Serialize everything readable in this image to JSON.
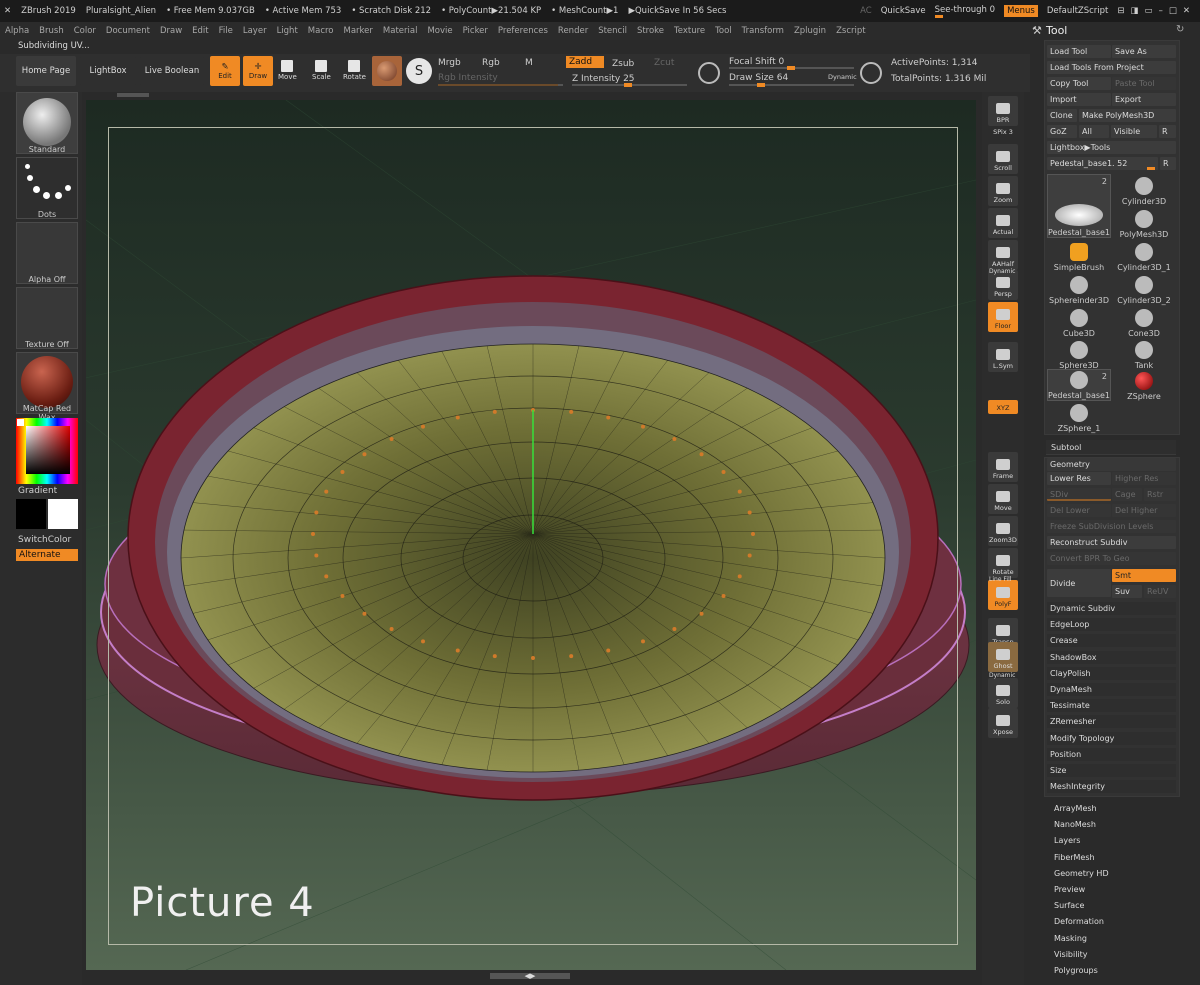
{
  "titlebar": {
    "app": "ZBrush 2019",
    "file": "Pluralsight_Alien",
    "free_mem": "• Free Mem 9.037GB",
    "active_mem": "• Active Mem 753",
    "scratch": "• Scratch Disk 212",
    "polycount": "• PolyCount▶21.504 KP",
    "meshcount": "• MeshCount▶1",
    "quicksave_in": "▶QuickSave In 56 Secs",
    "ac": "AC",
    "quicksave": "QuickSave",
    "seethrough": "See-through",
    "seethrough_val": "0",
    "menus": "Menus",
    "script": "DefaultZScript"
  },
  "menus": [
    "Alpha",
    "Brush",
    "Color",
    "Document",
    "Draw",
    "Edit",
    "File",
    "Layer",
    "Light",
    "Macro",
    "Marker",
    "Material",
    "Movie",
    "Picker",
    "Preferences",
    "Render",
    "Stencil",
    "Stroke",
    "Texture",
    "Tool",
    "Transform",
    "Zplugin",
    "Zscript"
  ],
  "subdiv_status": "Subdividing UV...",
  "toolbar": {
    "home": "Home Page",
    "lightbox": "LightBox",
    "liveboolean": "Live Boolean",
    "edit": "Edit",
    "draw": "Draw",
    "move": "Move",
    "scale": "Scale",
    "rotate": "Rotate",
    "mrgb": "Mrgb",
    "rgb": "Rgb",
    "m": "M",
    "zadd": "Zadd",
    "zsub": "Zsub",
    "zcut": "Zcut",
    "rgb_intensity": "Rgb Intensity",
    "z_intensity": "Z Intensity",
    "z_intensity_val": "25",
    "focal_shift": "Focal Shift",
    "focal_shift_val": "0",
    "draw_size": "Draw Size",
    "draw_size_val": "64",
    "dynamic": "Dynamic",
    "active_points": "ActivePoints: 1,314",
    "total_points": "TotalPoints: 1.316 Mil"
  },
  "leftshelf": {
    "brush": "Standard",
    "stroke": "Dots",
    "alpha": "Alpha Off",
    "texture": "Texture Off",
    "material": "MatCap Red Wax",
    "gradient": "Gradient",
    "switchcolor": "SwitchColor",
    "alternate": "Alternate"
  },
  "rightshelf": [
    "BPR",
    "SPix 3",
    "Scroll",
    "Zoom",
    "Actual",
    "AAHalf",
    "Persp",
    "Floor",
    "L.Sym",
    "",
    "XYZ",
    "",
    "",
    "Frame",
    "Move",
    "Zoom3D",
    "Rotate",
    "PolyF",
    "Transp",
    "Ghost",
    "Solo",
    "Xpose"
  ],
  "rightshelf_extra": {
    "dynamic": "Dynamic",
    "linefill": "Line Fill"
  },
  "tool": {
    "title": "Tool",
    "load": "Load Tool",
    "saveas": "Save As",
    "load_project": "Load Tools From Project",
    "copy": "Copy Tool",
    "paste": "Paste Tool",
    "import": "Import",
    "export": "Export",
    "clone": "Clone",
    "make_poly": "Make PolyMesh3D",
    "goz": "GoZ",
    "all": "All",
    "visible": "Visible",
    "r": "R",
    "lightbox_tools": "Lightbox▶Tools",
    "current_tool": "Pedestal_base1. 52",
    "thumbs": [
      "Pedestal_base1",
      "Cylinder3D",
      "PolyMesh3D",
      "SimpleBrush",
      "Cylinder3D_1",
      "Sphereinder3D",
      "Cylinder3D_2",
      "Cube3D",
      "Cone3D",
      "Sphere3D",
      "Tank",
      "Pedestal_base1",
      "ZSphere",
      "ZSphere_1"
    ],
    "thumb_badge": "2",
    "subtool": "Subtool",
    "geometry": "Geometry",
    "lower_res": "Lower Res",
    "higher_res": "Higher Res",
    "sdiv": "SDiv",
    "cage": "Cage",
    "rstr": "Rstr",
    "del_lower": "Del Lower",
    "del_higher": "Del Higher",
    "freeze": "Freeze SubDivision Levels",
    "reconstruct": "Reconstruct Subdiv",
    "convert_bpr": "Convert BPR To Geo",
    "divide": "Divide",
    "smt": "Smt",
    "suv": "Suv",
    "reuv": "ReUV",
    "geo_sections": [
      "Dynamic Subdiv",
      "EdgeLoop",
      "Crease",
      "ShadowBox",
      "ClayPolish",
      "DynaMesh",
      "Tessimate",
      "ZRemesher",
      "Modify Topology",
      "Position",
      "Size",
      "MeshIntegrity"
    ],
    "sections": [
      "ArrayMesh",
      "NanoMesh",
      "Layers",
      "FiberMesh",
      "Geometry HD",
      "Preview",
      "Surface",
      "Deformation",
      "Masking",
      "Visibility",
      "Polygroups"
    ]
  },
  "canvas": {
    "label": "Picture 4"
  },
  "colors": {
    "accent": "#f08a24",
    "rim": "#7a2430",
    "bowl": "#7a7a3a"
  }
}
